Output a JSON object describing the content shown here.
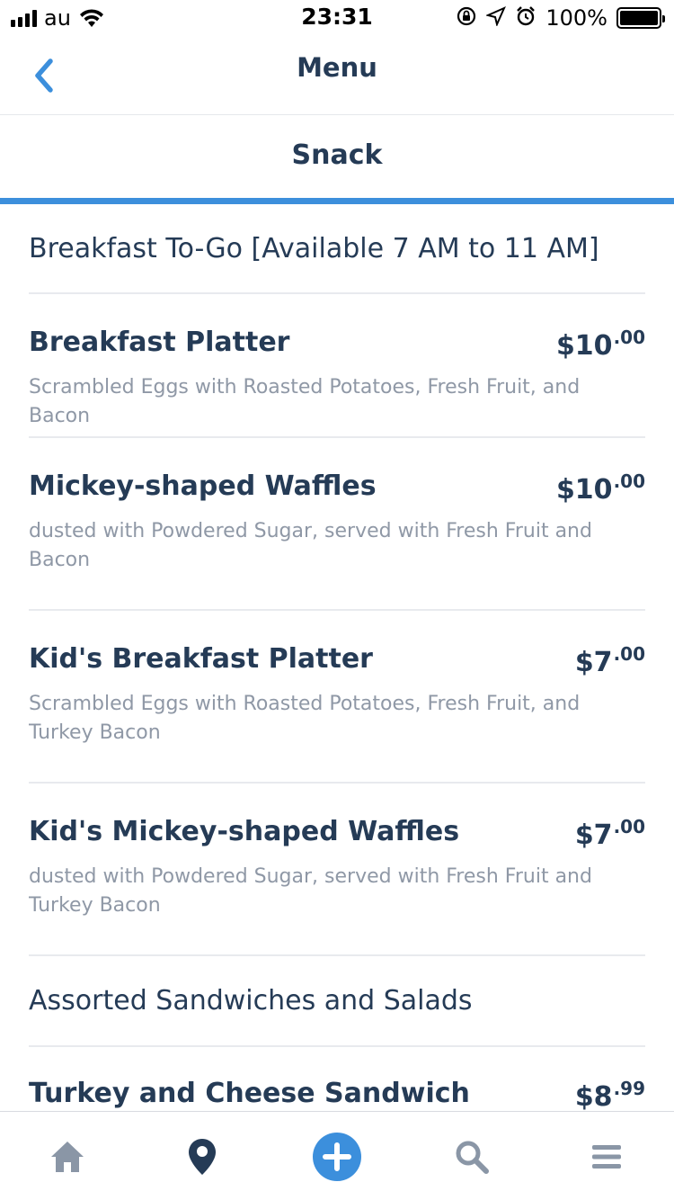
{
  "status_bar": {
    "carrier": "au",
    "time": "23:31",
    "battery": "100%"
  },
  "nav": {
    "title": "Menu",
    "back_icon": "chevron-left-icon"
  },
  "tab": {
    "label": "Snack",
    "accent_color": "#3C8FDC"
  },
  "sections": [
    {
      "title": "Breakfast To-Go [Available 7 AM to 11 AM]",
      "items": [
        {
          "name": "Breakfast Platter",
          "price_dollars": "$10",
          "price_cents": ".00",
          "desc": "Scrambled Eggs with Roasted Potatoes, Fresh Fruit, and Bacon"
        },
        {
          "name": "Mickey-shaped Waffles",
          "price_dollars": "$10",
          "price_cents": ".00",
          "desc": "dusted with Powdered Sugar, served with Fresh Fruit and Bacon"
        },
        {
          "name": "Kid's Breakfast Platter",
          "price_dollars": "$7",
          "price_cents": ".00",
          "desc": "Scrambled Eggs with Roasted Potatoes, Fresh Fruit, and Turkey Bacon"
        },
        {
          "name": "Kid's Mickey-shaped Waffles",
          "price_dollars": "$7",
          "price_cents": ".00",
          "desc": "dusted with Powdered Sugar, served with Fresh Fruit and Turkey Bacon"
        }
      ]
    },
    {
      "title": "Assorted Sandwiches and Salads",
      "items": [
        {
          "name": "Turkey and Cheese Sandwich",
          "price_dollars": "$8",
          "price_cents": ".99"
        }
      ]
    }
  ],
  "bottom_bar": {
    "icons": [
      "home-icon",
      "location-pin-icon",
      "plus-icon",
      "search-icon",
      "menu-icon"
    ]
  },
  "colors": {
    "text_primary": "#253B56",
    "text_secondary": "#8F98A6",
    "accent": "#3C8FDC"
  }
}
